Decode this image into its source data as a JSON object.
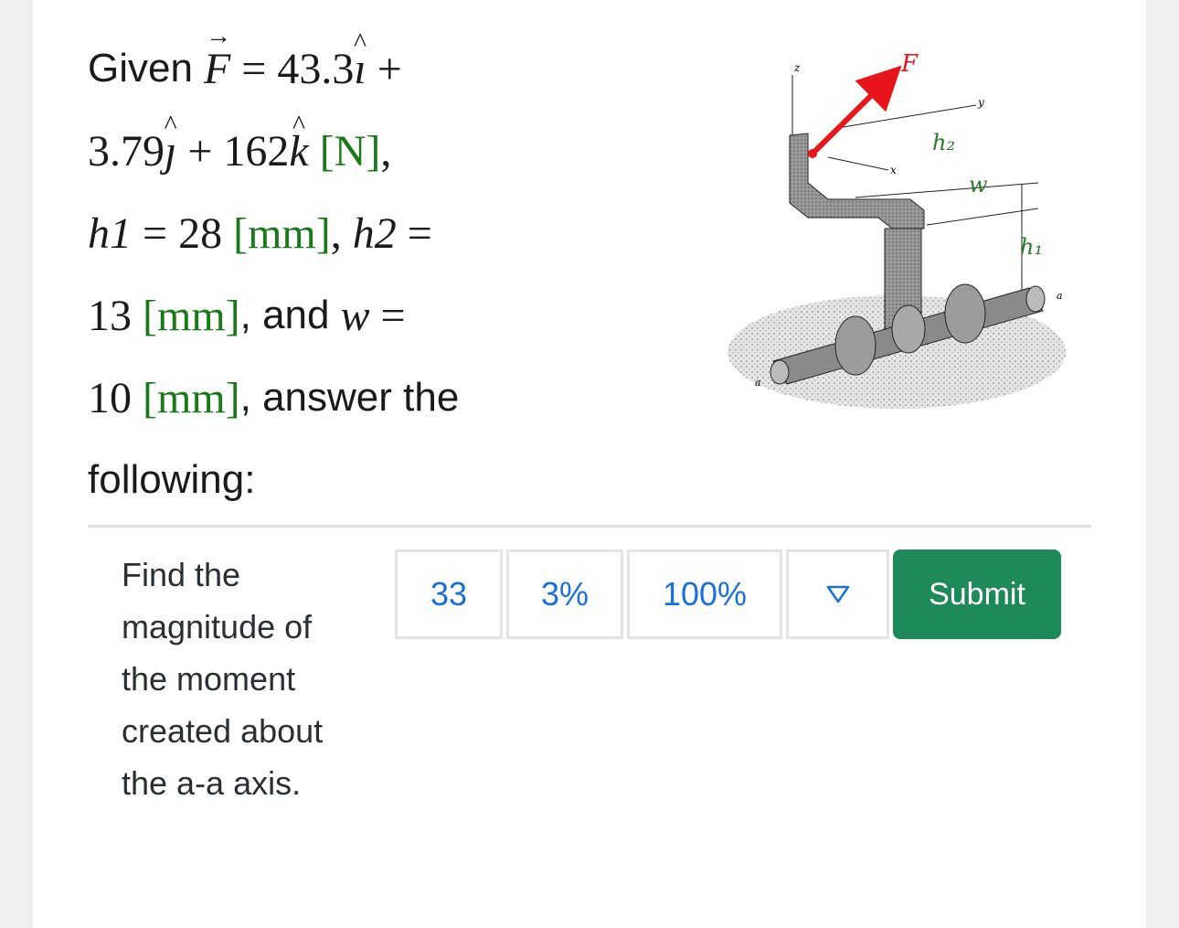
{
  "problem": {
    "given": "Given",
    "F_sym": "F",
    "eq": "=",
    "plus": "+",
    "fx": "43.3",
    "i": "ı",
    "fy": "3.79",
    "j": "ȷ",
    "fz": "162",
    "k": "k",
    "unit_N": "[N]",
    "comma": ",",
    "h1_sym": "h1",
    "h1_val": "28",
    "unit_mm": "[mm]",
    "h2_sym": "h2",
    "h2_val": "13",
    "and": ", and",
    "w_sym": "w",
    "w_val": "10",
    "answer_the": ", answer the",
    "following": "following:"
  },
  "figure": {
    "label_F": "F",
    "label_z": "z",
    "label_y": "y",
    "label_x": "x",
    "label_h2": "h₂",
    "label_w": "w",
    "label_h1": "h₁",
    "label_a1": "a",
    "label_a2": "a"
  },
  "question": {
    "text": "Find the magnitude of the moment created about the a-a axis."
  },
  "answer": {
    "value": "33",
    "sig_figs": "3%",
    "tolerance": "100%",
    "submit_label": "Submit"
  },
  "colors": {
    "unit_green": "#1a7a1a",
    "link_blue": "#1a6fd8",
    "submit_green": "#1d8a57",
    "force_red": "#e8161a"
  },
  "icons": {
    "dropdown": "triangle-down-icon"
  }
}
